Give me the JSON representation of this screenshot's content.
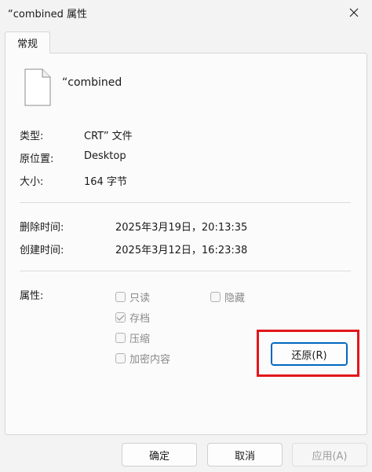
{
  "window": {
    "title": "“combined 属性"
  },
  "tabs": [
    {
      "label": "常规"
    }
  ],
  "file": {
    "name": "“combined"
  },
  "info": {
    "type_label": "类型:",
    "type_value": "CRT” 文件",
    "location_label": "原位置:",
    "location_value": "Desktop",
    "size_label": "大小:",
    "size_value": "164 字节",
    "deleted_label": "删除时间:",
    "deleted_value": "2025年3月19日，20:13:35",
    "created_label": "创建时间:",
    "created_value": "2025年3月12日，16:23:38"
  },
  "attributes": {
    "label": "属性:",
    "readonly": {
      "label": "只读",
      "checked": false
    },
    "hidden": {
      "label": "隐藏",
      "checked": false
    },
    "archive": {
      "label": "存档",
      "checked": true
    },
    "compress": {
      "label": "压缩",
      "checked": false
    },
    "encrypt": {
      "label": "加密内容",
      "checked": false
    }
  },
  "buttons": {
    "restore": "还原(R)",
    "ok": "确定",
    "cancel": "取消",
    "apply": "应用(A)"
  },
  "colors": {
    "highlight": "#e3171b",
    "accent": "#0067c0"
  },
  "icons": {
    "close": "close-icon",
    "file": "file-icon"
  }
}
